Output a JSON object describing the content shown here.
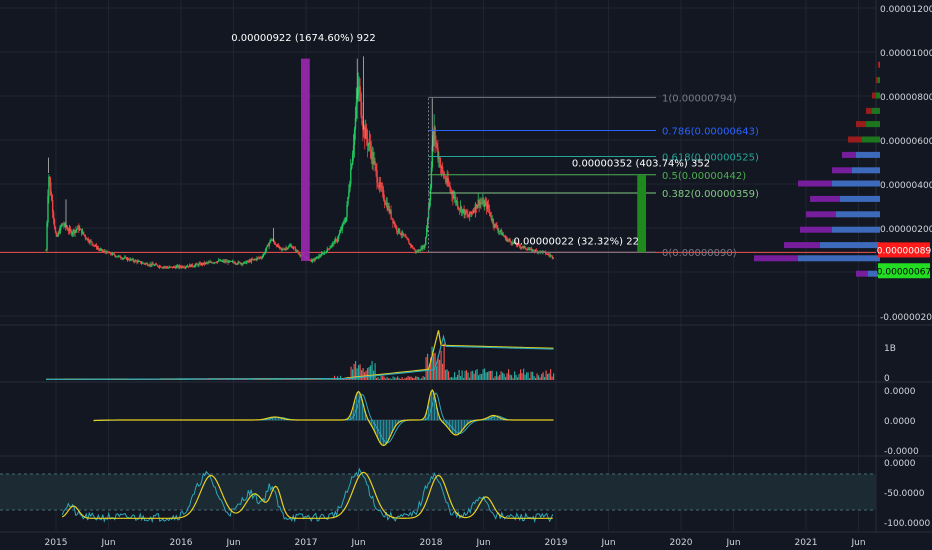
{
  "chart_data": [
    {
      "type": "candlestick",
      "panel": "price",
      "x_ticks": [
        "2015",
        "Jun",
        "2016",
        "Jun",
        "2017",
        "Jun",
        "2018",
        "Jun",
        "2019",
        "Jun",
        "2020",
        "Jun",
        "2021",
        "Jun"
      ],
      "y_ticks": [
        "0.00001200",
        "0.00001000",
        "0.00000800",
        "0.00000600",
        "0.00000400",
        "0.00000200",
        "-0.00000200"
      ],
      "ylim": [
        -2.2e-06,
        1.26e-05
      ],
      "price_series": [
        {
          "t": 2014.92,
          "v": 1e-06
        },
        {
          "t": 2014.94,
          "v": 4.5e-06
        },
        {
          "t": 2014.97,
          "v": 3e-06
        },
        {
          "t": 2015.0,
          "v": 1.5e-06
        },
        {
          "t": 2015.05,
          "v": 2.2e-06
        },
        {
          "t": 2015.12,
          "v": 1.8e-06
        },
        {
          "t": 2015.18,
          "v": 2e-06
        },
        {
          "t": 2015.25,
          "v": 1.5e-06
        },
        {
          "t": 2015.35,
          "v": 1e-06
        },
        {
          "t": 2015.5,
          "v": 7e-07
        },
        {
          "t": 2015.7,
          "v": 4e-07
        },
        {
          "t": 2015.9,
          "v": 2e-07
        },
        {
          "t": 2016.1,
          "v": 3e-07
        },
        {
          "t": 2016.3,
          "v": 5e-07
        },
        {
          "t": 2016.5,
          "v": 4e-07
        },
        {
          "t": 2016.65,
          "v": 7e-07
        },
        {
          "t": 2016.72,
          "v": 1.5e-06
        },
        {
          "t": 2016.8,
          "v": 1e-06
        },
        {
          "t": 2016.88,
          "v": 1.2e-06
        },
        {
          "t": 2016.95,
          "v": 8e-07
        },
        {
          "t": 2017.05,
          "v": 5e-07
        },
        {
          "t": 2017.15,
          "v": 9e-07
        },
        {
          "t": 2017.25,
          "v": 1.5e-06
        },
        {
          "t": 2017.32,
          "v": 2.5e-06
        },
        {
          "t": 2017.38,
          "v": 6e-06
        },
        {
          "t": 2017.42,
          "v": 8.5e-06
        },
        {
          "t": 2017.46,
          "v": 6.5e-06
        },
        {
          "t": 2017.52,
          "v": 5.5e-06
        },
        {
          "t": 2017.58,
          "v": 4e-06
        },
        {
          "t": 2017.65,
          "v": 3e-06
        },
        {
          "t": 2017.72,
          "v": 2e-06
        },
        {
          "t": 2017.8,
          "v": 1.5e-06
        },
        {
          "t": 2017.88,
          "v": 9e-07
        },
        {
          "t": 2017.95,
          "v": 1.2e-06
        },
        {
          "t": 2017.99,
          "v": 3.5e-06
        },
        {
          "t": 2018.02,
          "v": 6.5e-06
        },
        {
          "t": 2018.05,
          "v": 5.5e-06
        },
        {
          "t": 2018.09,
          "v": 4.5e-06
        },
        {
          "t": 2018.15,
          "v": 3.8e-06
        },
        {
          "t": 2018.22,
          "v": 3e-06
        },
        {
          "t": 2018.3,
          "v": 2.5e-06
        },
        {
          "t": 2018.38,
          "v": 3.2e-06
        },
        {
          "t": 2018.45,
          "v": 3e-06
        },
        {
          "t": 2018.5,
          "v": 2.2e-06
        },
        {
          "t": 2018.6,
          "v": 1.5e-06
        },
        {
          "t": 2018.7,
          "v": 1.2e-06
        },
        {
          "t": 2018.8,
          "v": 1e-06
        },
        {
          "t": 2018.9,
          "v": 9e-07
        },
        {
          "t": 2018.97,
          "v": 7e-07
        }
      ],
      "fibonacci": [
        {
          "label": "1(0.00000794)",
          "value": 7.94e-06,
          "color": "#787b86"
        },
        {
          "label": "0.786(0.00000643)",
          "value": 6.43e-06,
          "color": "#2962ff"
        },
        {
          "label": "0.618(0.00000525)",
          "value": 5.25e-06,
          "color": "#26a69a"
        },
        {
          "label": "0.5(0.00000442)",
          "value": 4.42e-06,
          "color": "#4caf50"
        },
        {
          "label": "0.382(0.00000359)",
          "value": 3.59e-06,
          "color": "#81c784"
        },
        {
          "label": "0(0.00000090)",
          "value": 9e-07,
          "color": "#787b86"
        }
      ],
      "price_range_annotations": [
        {
          "label": "0.00000922 (1674.60%) 922",
          "from": 5e-07,
          "to": 9.7e-06,
          "t0": 2016.96,
          "t1": 2017.03,
          "color": "#9c27b0"
        },
        {
          "label": "0.00000352 (403.74%) 352",
          "from": 9e-07,
          "to": 4.4e-06,
          "t0": 2019.65,
          "t1": 2019.72,
          "color": "#1e8a1e"
        },
        {
          "label": "0.00000022 (32.32%) 22",
          "from": 7e-07,
          "to": 9e-07,
          "t0": 2018.72,
          "t1": 2018.98,
          "color": "#ffffff"
        }
      ],
      "price_labels": [
        {
          "text": "0.00000089",
          "value": 8.9e-07,
          "color": "#ff1a1a"
        },
        {
          "text": "0.00000067",
          "value": 6.7e-07,
          "color": "#22dd22"
        }
      ],
      "volume_profile": [
        {
          "value": 9.4e-06,
          "up": 1.0,
          "down": 1.0
        },
        {
          "value": 8.7e-06,
          "up": 2.0,
          "down": 2.0
        },
        {
          "value": 8e-06,
          "up": 4.0,
          "down": 4.0
        },
        {
          "value": 7.3e-06,
          "up": 8.0,
          "down": 6.0
        },
        {
          "value": 6.7e-06,
          "up": 14.0,
          "down": 10.0
        },
        {
          "value": 6e-06,
          "up": 18.0,
          "down": 14.0
        },
        {
          "value": 5.3e-06,
          "up": 24.0,
          "down": 14.0
        },
        {
          "value": 4.6e-06,
          "up": 28.0,
          "down": 20.0
        },
        {
          "value": 4e-06,
          "up": 48.0,
          "down": 34.0
        },
        {
          "value": 3.3e-06,
          "up": 40.0,
          "down": 30.0
        },
        {
          "value": 2.6e-06,
          "up": 44.0,
          "down": 30.0
        },
        {
          "value": 1.9e-06,
          "up": 48.0,
          "down": 32.0
        },
        {
          "value": 1.2e-06,
          "up": 60.0,
          "down": 36.0
        },
        {
          "value": 6e-07,
          "up": 82.0,
          "down": 44.0
        },
        {
          "value": -1e-07,
          "up": 12.0,
          "down": 12.0
        }
      ]
    },
    {
      "type": "line",
      "panel": "volume",
      "y_ticks": [
        "1B",
        "0"
      ],
      "ylim": [
        0,
        1.6
      ]
    },
    {
      "type": "line",
      "panel": "macd",
      "y_ticks": [
        "0.0000",
        "0.0000",
        "-0.0000"
      ],
      "ylim": [
        -1.2,
        1.2
      ]
    },
    {
      "type": "line",
      "panel": "williams_r",
      "y_ticks": [
        "0.0000",
        "-50.0000",
        "-100.0000"
      ],
      "ylim": [
        -108,
        2
      ],
      "band": [
        -80,
        -20
      ]
    }
  ],
  "colors": {
    "background": "#131722",
    "grid": "#1f2433",
    "up": "#26a69a",
    "down": "#ef5350",
    "axis_text": "#d1d4dc",
    "yellow": "#e6d020",
    "teal": "#2ea6b8"
  }
}
